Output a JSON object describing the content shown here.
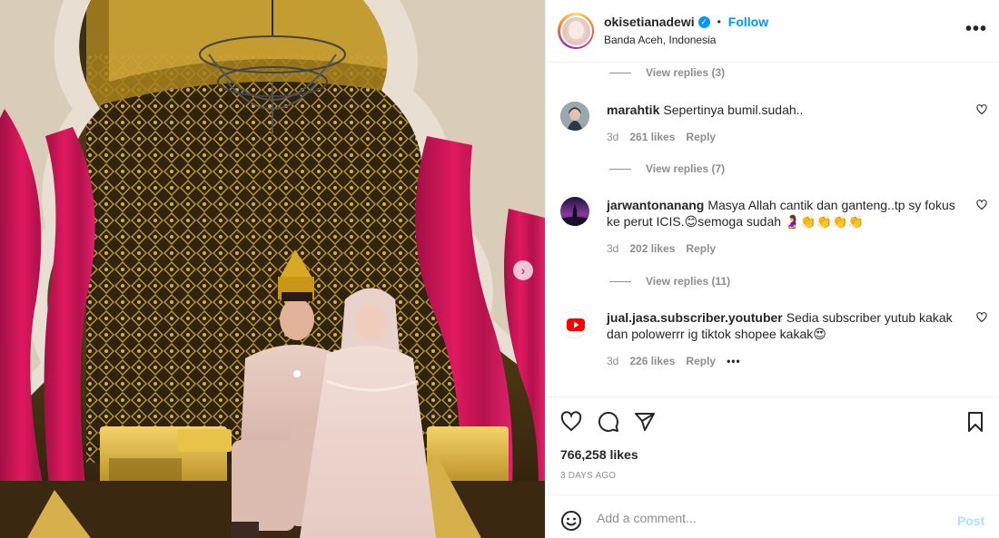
{
  "header": {
    "username": "okisetianadewi",
    "verified_mark": "✓",
    "separator": "•",
    "follow_label": "Follow",
    "location": "Banda Aceh, Indonesia",
    "more_label": "•••"
  },
  "comments": {
    "replies": [
      {
        "label": "View replies (3)"
      },
      {
        "label": "View replies (7)"
      },
      {
        "label": "View replies (11)"
      }
    ],
    "items": [
      {
        "username": "marahtik",
        "text": "Sepertinya bumil.sudah..",
        "age": "3d",
        "likes": "261 likes",
        "reply": "Reply",
        "avatar_icon": "profile-photo"
      },
      {
        "username": "jarwantonanang",
        "text": "Masya Allah cantik dan ganteng..tp sy fokus ke perut ICIS.😊semoga sudah  🤰👏👏👏👏",
        "age": "3d",
        "likes": "202 likes",
        "reply": "Reply",
        "avatar_icon": "profile-photo"
      },
      {
        "username": "jual.jasa.subscriber.youtuber",
        "text": "Sedia subscriber yutub kakak dan polowerrr ig tiktok shopee kakak😍",
        "age": "3d",
        "likes": "226 likes",
        "reply": "Reply",
        "more": "•••",
        "avatar_icon": "youtube-icon"
      }
    ]
  },
  "actions": {
    "likes_count": "766,258 likes",
    "timestamp": "3 DAYS AGO"
  },
  "add_comment": {
    "placeholder": "Add a comment...",
    "post_label": "Post"
  },
  "photo": {
    "next_arrow": "›"
  },
  "colors": {
    "accent": "#0095f6",
    "post_disabled": "#b2dffc",
    "muted": "#8e8e8e"
  }
}
